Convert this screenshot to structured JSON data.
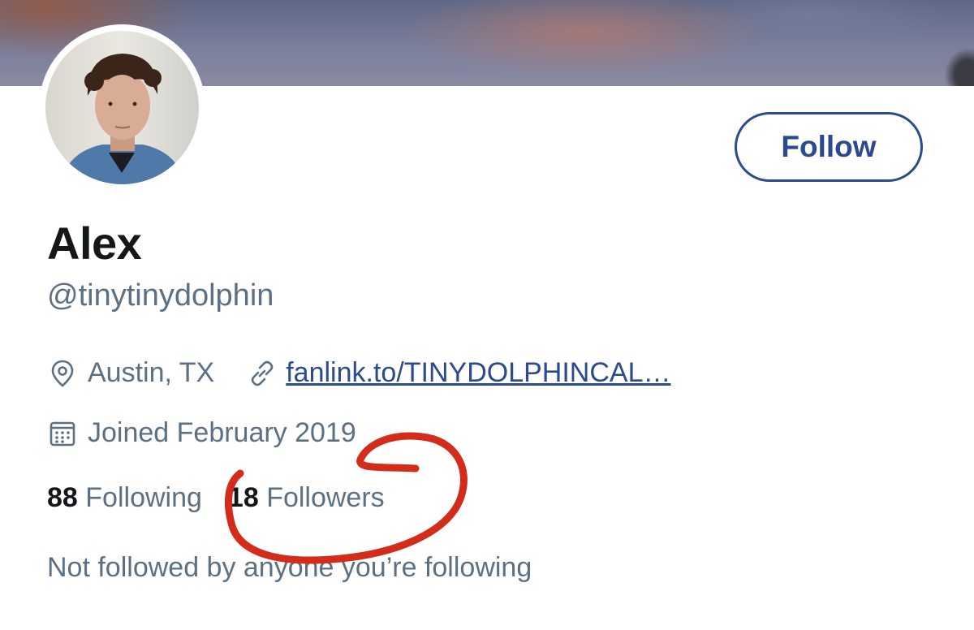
{
  "colors": {
    "accent": "#2c4a8e",
    "secondary_text": "#5b7083",
    "primary_text": "#14171a",
    "annotation": "#d42c1a"
  },
  "profile": {
    "name": "Alex",
    "handle": "@tinytinydolphin",
    "location": "Austin, TX",
    "website": "fanlink.to/TINYDOLPHINCAL…",
    "joined": "Joined February 2019",
    "following_count": "88",
    "following_label": "Following",
    "followers_count": "18",
    "followers_label": "Followers",
    "social_context": "Not followed by anyone you’re following"
  },
  "actions": {
    "follow_label": "Follow"
  },
  "icons": {
    "location": "map-pin-icon",
    "link": "link-icon",
    "calendar": "calendar-icon"
  }
}
